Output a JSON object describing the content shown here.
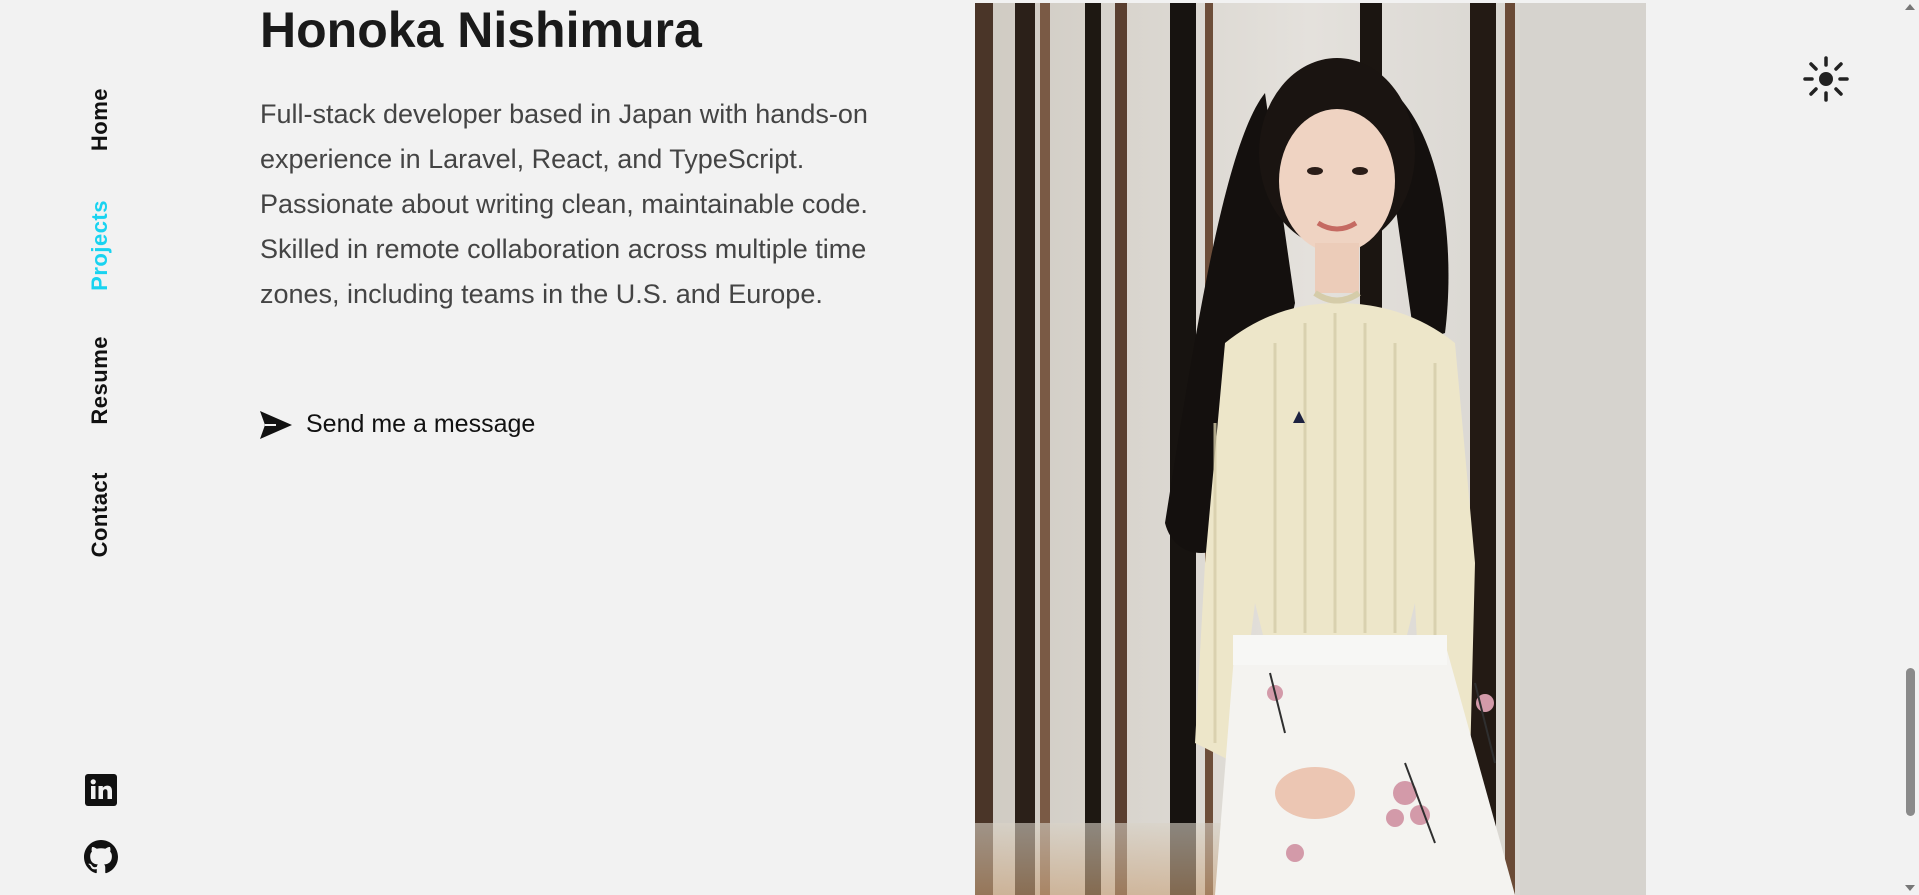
{
  "nav": {
    "items": [
      {
        "label": "Home",
        "active": false
      },
      {
        "label": "Projects",
        "active": true
      },
      {
        "label": "Resume",
        "active": false
      },
      {
        "label": "Contact",
        "active": false
      }
    ],
    "active_color": "#19d3f0"
  },
  "social": {
    "linkedin_icon": "linkedin-icon",
    "github_icon": "github-icon"
  },
  "intro": {
    "name": "Honoka Nishimura",
    "bio": "Full-stack developer based in Japan with hands-on experience in Laravel, React, and TypeScript. Passionate about writing clean, maintainable code. Skilled in remote collaboration across multiple time zones, including teams in the U.S. and Europe.",
    "cta_label": "Send me a message",
    "cta_icon": "send-icon"
  },
  "photo": {
    "icon": "profile-photo"
  },
  "theme_toggle": {
    "icon": "sun-icon"
  }
}
